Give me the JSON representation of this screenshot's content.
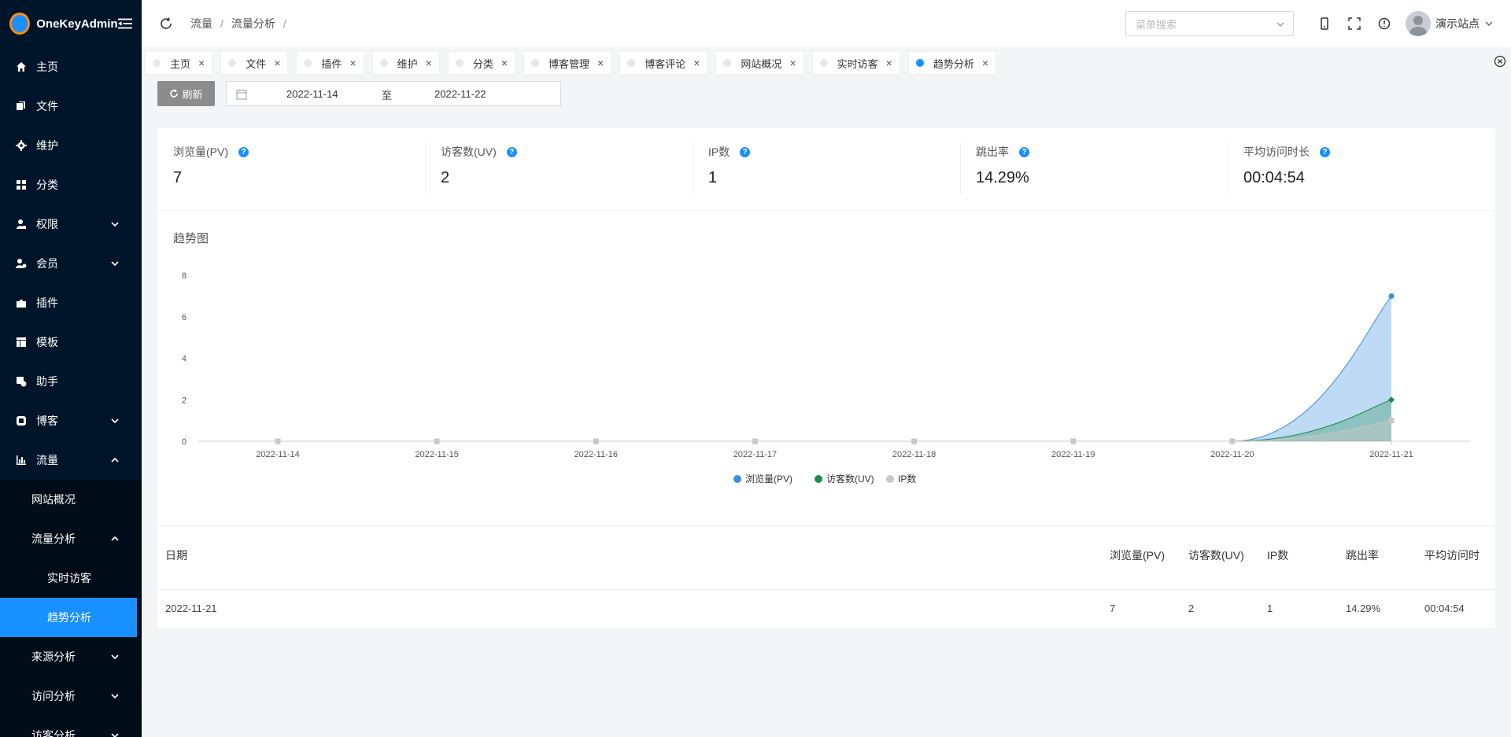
{
  "app": {
    "title": "OneKeyAdmin"
  },
  "sidebar": {
    "items": [
      {
        "label": "主页",
        "icon": "home-icon"
      },
      {
        "label": "文件",
        "icon": "file-icon"
      },
      {
        "label": "维护",
        "icon": "gear-icon"
      },
      {
        "label": "分类",
        "icon": "grid-icon"
      },
      {
        "label": "权限",
        "icon": "user-lock-icon",
        "expandable": true
      },
      {
        "label": "会员",
        "icon": "member-icon",
        "expandable": true
      },
      {
        "label": "插件",
        "icon": "puzzle-icon"
      },
      {
        "label": "模板",
        "icon": "template-icon"
      },
      {
        "label": "助手",
        "icon": "assistant-icon"
      },
      {
        "label": "博客",
        "icon": "blog-icon",
        "expandable": true
      },
      {
        "label": "流量",
        "icon": "bar-chart-icon",
        "expanded": true
      }
    ],
    "traffic_sub": {
      "overview": "网站概况",
      "analysis": "流量分析",
      "realtime": "实时访客",
      "trend": "趋势分析",
      "source": "来源分析",
      "visit": "访问分析",
      "more": "访客分析"
    }
  },
  "header": {
    "breadcrumb": [
      "流量",
      "流量分析"
    ],
    "search_placeholder": "菜单搜索",
    "user_name": "演示站点"
  },
  "tabs": [
    {
      "label": "主页",
      "active": false
    },
    {
      "label": "文件",
      "active": false
    },
    {
      "label": "插件",
      "active": false
    },
    {
      "label": "维护",
      "active": false
    },
    {
      "label": "分类",
      "active": false
    },
    {
      "label": "博客管理",
      "active": false
    },
    {
      "label": "博客评论",
      "active": false
    },
    {
      "label": "网站概况",
      "active": false
    },
    {
      "label": "实时访客",
      "active": false
    },
    {
      "label": "趋势分析",
      "active": true
    }
  ],
  "toolbar": {
    "refresh_label": "刷新",
    "start_date": "2022-11-14",
    "range_sep": "至",
    "end_date": "2022-11-22"
  },
  "stats": [
    {
      "label": "浏览量(PV)",
      "value": "7"
    },
    {
      "label": "访客数(UV)",
      "value": "2"
    },
    {
      "label": "IP数",
      "value": "1"
    },
    {
      "label": "跳出率",
      "value": "14.29%"
    },
    {
      "label": "平均访问时长",
      "value": "00:04:54"
    }
  ],
  "trend": {
    "title": "趋势图"
  },
  "chart_data": {
    "type": "area",
    "title": "趋势图",
    "x": [
      "2022-11-14",
      "2022-11-15",
      "2022-11-16",
      "2022-11-17",
      "2022-11-18",
      "2022-11-19",
      "2022-11-20",
      "2022-11-21"
    ],
    "series": [
      {
        "name": "浏览量(PV)",
        "values": [
          0,
          0,
          0,
          0,
          0,
          0,
          0,
          7
        ],
        "color": "#3b8fe0"
      },
      {
        "name": "访客数(UV)",
        "values": [
          0,
          0,
          0,
          0,
          0,
          0,
          0,
          2
        ],
        "color": "#1f8a46"
      },
      {
        "name": "IP数",
        "values": [
          0,
          0,
          0,
          0,
          0,
          0,
          0,
          1
        ],
        "color": "#c8c8c8"
      }
    ],
    "y_ticks": [
      "0",
      "2",
      "4",
      "6",
      "8"
    ],
    "ylim": [
      0,
      8
    ],
    "legend": "bottom-center",
    "grid": false
  },
  "table": {
    "columns": [
      "日期",
      "浏览量(PV)",
      "访客数(UV)",
      "IP数",
      "跳出率",
      "平均访问时"
    ],
    "rows": [
      [
        "2022-11-21",
        "7",
        "2",
        "1",
        "14.29%",
        "00:04:54"
      ]
    ]
  }
}
